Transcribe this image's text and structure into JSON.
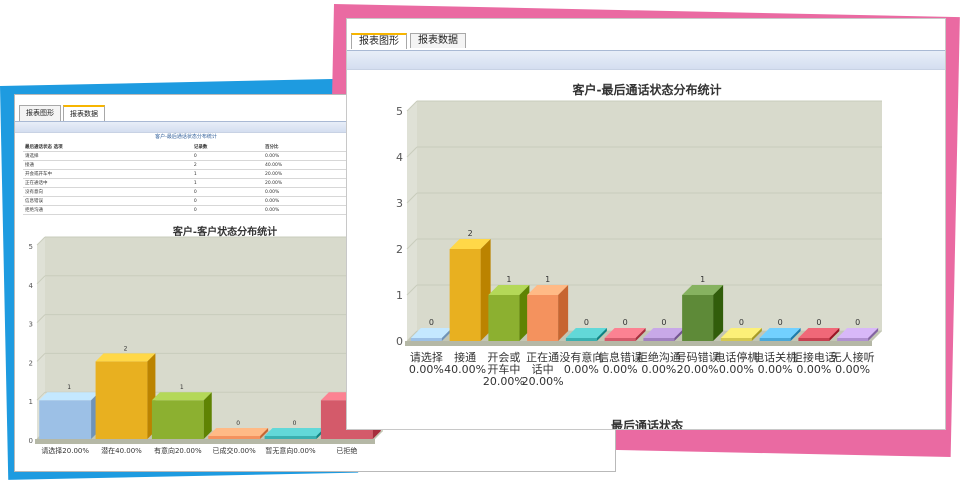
{
  "colors": {
    "blue_frame": "#1e9be0",
    "pink_frame": "#ea6aa2",
    "tab_accent": "#f7b500"
  },
  "left_panel": {
    "tabs": [
      "报表图形",
      "报表数据"
    ],
    "table": {
      "caption": "客户-最后通话状态分布统计",
      "headers": [
        "最后通话状态 选项",
        "记录数",
        "百分比"
      ],
      "rows": [
        [
          "请选择",
          "0",
          "0.00%"
        ],
        [
          "接通",
          "2",
          "40.00%"
        ],
        [
          "开会或开车中",
          "1",
          "20.00%"
        ],
        [
          "正在通话中",
          "1",
          "20.00%"
        ],
        [
          "没有意向",
          "0",
          "0.00%"
        ],
        [
          "信息错误",
          "0",
          "0.00%"
        ],
        [
          "拒绝沟通",
          "0",
          "0.00%"
        ]
      ]
    },
    "chart_title": "客户-客户状态分布统计"
  },
  "right_panel": {
    "tabs": [
      "报表图形",
      "报表数据"
    ],
    "chart_title": "客户-最后通话状态分布统计",
    "axis_title": "最后通话状态"
  },
  "chart_data": [
    {
      "type": "bar",
      "title": "客户-客户状态分布统计",
      "categories": [
        "请选择20.00%",
        "潜在40.00%",
        "有意向20.00%",
        "已成交0.00%",
        "暂无意向0.00%",
        "已拒绝"
      ],
      "values": [
        1,
        2,
        1,
        0,
        0,
        1
      ],
      "ylim": [
        0,
        5
      ],
      "xlabel": "",
      "ylabel": ""
    },
    {
      "type": "bar",
      "title": "客户-最后通话状态分布统计",
      "categories": [
        "请选择0.00%",
        "接通40.00%",
        "开会或开车中20.00%",
        "正在通话中20.00%",
        "没有意向0.00%",
        "信息错误0.00%",
        "拒绝沟通0.00%",
        "号码错误20.00%",
        "电话停机0.00%",
        "电话关机0.00%",
        "拒接电话0.00%",
        "无人接听0.00%"
      ],
      "values": [
        0,
        2,
        1,
        1,
        0,
        0,
        0,
        1,
        0,
        0,
        0,
        0
      ],
      "ylim": [
        0,
        5
      ],
      "xlabel": "最后通话状态",
      "ylabel": ""
    }
  ]
}
